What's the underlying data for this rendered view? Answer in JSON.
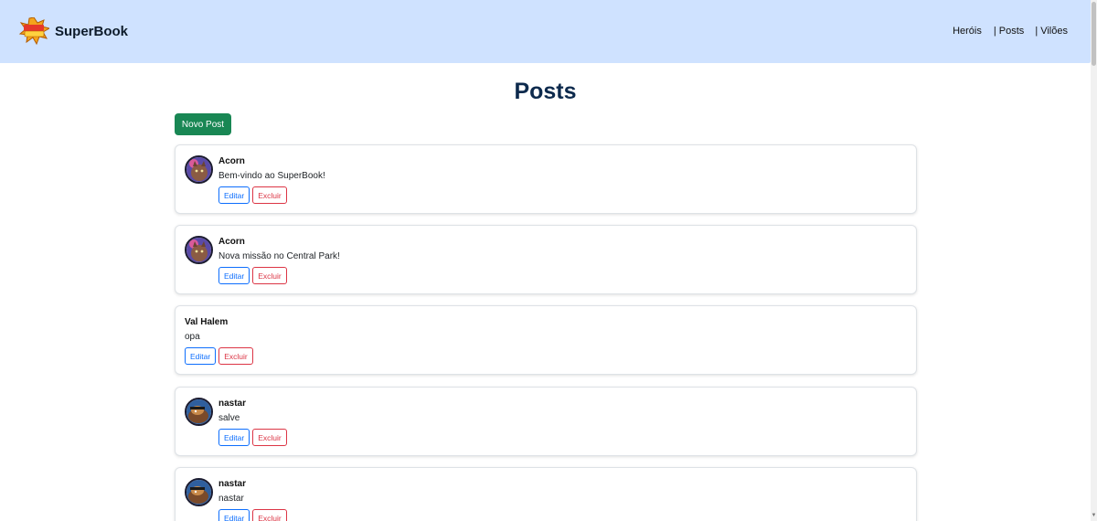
{
  "navbar": {
    "brand": "SuperBook",
    "links": [
      "Heróis",
      "| Posts",
      "| Vilões"
    ]
  },
  "page": {
    "title": "Posts",
    "new_post_label": "Novo Post"
  },
  "posts": [
    {
      "author": "Acorn",
      "content": "Bem-vindo ao SuperBook!",
      "has_avatar": true,
      "edit_label": "Editar",
      "delete_label": "Excluir"
    },
    {
      "author": "Acorn",
      "content": "Nova missão no Central Park!",
      "has_avatar": true,
      "edit_label": "Editar",
      "delete_label": "Excluir"
    },
    {
      "author": "Val Halem",
      "content": "opa",
      "has_avatar": false,
      "edit_label": "Editar",
      "delete_label": "Excluir"
    },
    {
      "author": "nastar",
      "content": "salve",
      "has_avatar": true,
      "edit_label": "Editar",
      "delete_label": "Excluir"
    },
    {
      "author": "nastar",
      "content": "nastar",
      "has_avatar": true,
      "edit_label": "Editar",
      "delete_label": "Excluir"
    }
  ],
  "colors": {
    "navbar_bg": "#cfe2ff",
    "primary": "#0d6efd",
    "success": "#198754",
    "danger": "#dc3545",
    "title": "#0d2a4d"
  }
}
